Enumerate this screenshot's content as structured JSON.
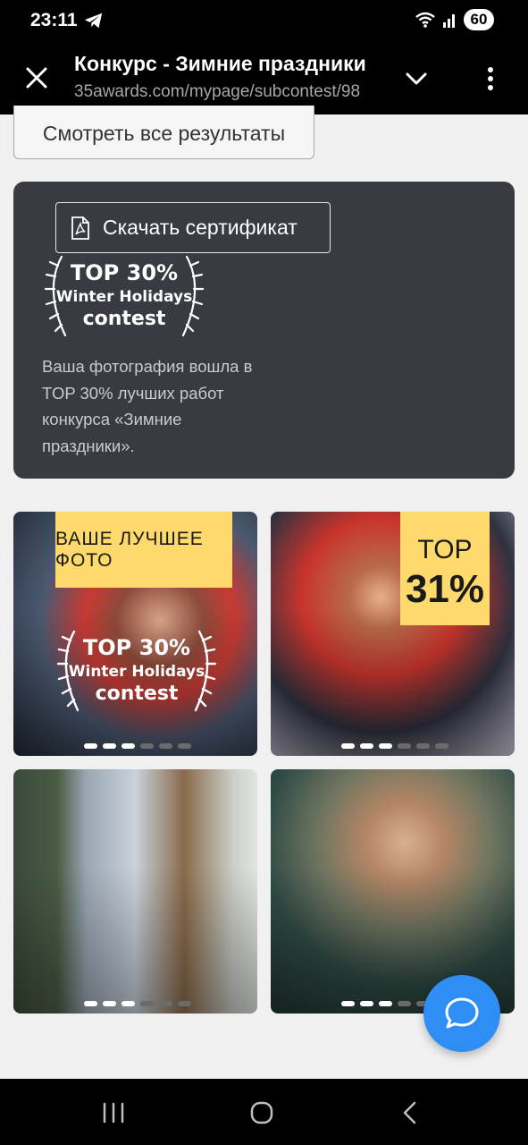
{
  "status": {
    "time": "23:11",
    "battery": "60"
  },
  "browser": {
    "title": "Конкурс - Зимние праздники",
    "url": "35awards.com/mypage/subcontest/98"
  },
  "results_button": "Смотреть все результаты",
  "certificate": {
    "download_label": "Скачать сертификат",
    "badge": {
      "line1": "TOP 30%",
      "line2": "Winter Holidays",
      "line3": "contest"
    },
    "description": "Ваша фотография вошла в TOP 30% лучших работ конкурса «Зимние праздники»."
  },
  "photos": {
    "best_label": "ВАШЕ ЛУЧШЕЕ ФОТО",
    "top_word": "TOP",
    "top_value": "31%",
    "badge": {
      "line1": "TOP 30%",
      "line2": "Winter Holidays",
      "line3": "contest"
    }
  },
  "colors": {
    "accent_yellow": "#fed96b",
    "card_bg": "#383b42",
    "fab_blue": "#2f8ef5"
  }
}
